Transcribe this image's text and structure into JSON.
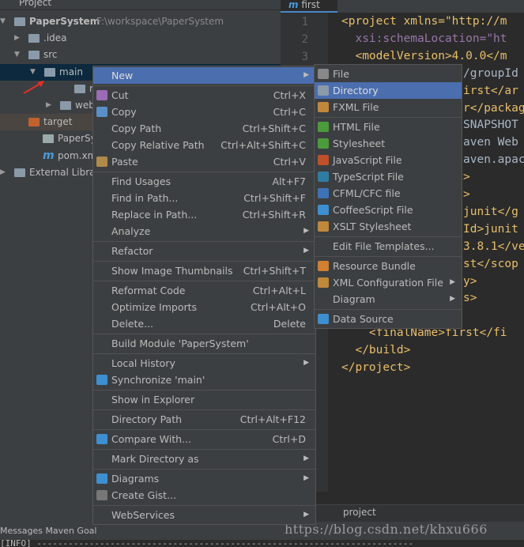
{
  "project_panel": {
    "title": "Project",
    "tree": [
      {
        "label": "PaperSystem",
        "path": "F:\\workspace\\PaperSystem",
        "icon": "module-folder-icon",
        "expanded": true
      },
      {
        "label": ".idea",
        "icon": "folder-icon",
        "expanded": false
      },
      {
        "label": "src",
        "icon": "folder-icon",
        "expanded": true
      },
      {
        "label": "main",
        "icon": "folder-icon",
        "expanded": true,
        "selected": true
      },
      {
        "label": "reso",
        "icon": "resources-folder-icon"
      },
      {
        "label": "web",
        "icon": "web-folder-icon",
        "expanded": false
      },
      {
        "label": "target",
        "icon": "excluded-folder-icon"
      },
      {
        "label": "PaperSyste",
        "icon": "iml-file-icon"
      },
      {
        "label": "pom.xml",
        "icon": "maven-icon"
      },
      {
        "label": "External Librar",
        "icon": "libraries-icon",
        "expanded": false
      }
    ]
  },
  "editor": {
    "tab": "first",
    "line_numbers": [
      "1",
      "2",
      "3"
    ],
    "lines": [
      "<project xmlns=\"http://m",
      "  xsi:schemaLocation=\"ht",
      "  <modelVersion>4.0.0</m",
      "/groupId",
      "irst</ar",
      "r</packag",
      "SNAPSHOT",
      "aven Web",
      "aven.apac",
      ">",
      ">",
      "junit</g",
      "Id>junit",
      "3.8.1</ve",
      "st</scop",
      "y>",
      "s>",
      "",
      "    <finalName>first</fi",
      "  </build>",
      "</project>"
    ],
    "breadcrumb": "project"
  },
  "context_menu": [
    {
      "label": "New",
      "submenu": true,
      "highlighted": true
    },
    {
      "sep": true
    },
    {
      "label": "Cut",
      "shortcut": "Ctrl+X",
      "icon": "scissors-icon"
    },
    {
      "label": "Copy",
      "shortcut": "Ctrl+C",
      "icon": "copy-icon"
    },
    {
      "label": "Copy Path",
      "shortcut": "Ctrl+Shift+C"
    },
    {
      "label": "Copy Relative Path",
      "shortcut": "Ctrl+Alt+Shift+C"
    },
    {
      "label": "Paste",
      "shortcut": "Ctrl+V",
      "icon": "paste-icon"
    },
    {
      "sep": true
    },
    {
      "label": "Find Usages",
      "shortcut": "Alt+F7"
    },
    {
      "label": "Find in Path...",
      "shortcut": "Ctrl+Shift+F"
    },
    {
      "label": "Replace in Path...",
      "shortcut": "Ctrl+Shift+R"
    },
    {
      "label": "Analyze",
      "submenu": true
    },
    {
      "sep": true
    },
    {
      "label": "Refactor",
      "submenu": true
    },
    {
      "sep": true
    },
    {
      "label": "Show Image Thumbnails",
      "shortcut": "Ctrl+Shift+T"
    },
    {
      "sep": true
    },
    {
      "label": "Reformat Code",
      "shortcut": "Ctrl+Alt+L"
    },
    {
      "label": "Optimize Imports",
      "shortcut": "Ctrl+Alt+O"
    },
    {
      "label": "Delete...",
      "shortcut": "Delete"
    },
    {
      "sep": true
    },
    {
      "label": "Build Module 'PaperSystem'"
    },
    {
      "sep": true
    },
    {
      "label": "Local History",
      "submenu": true
    },
    {
      "label": "Synchronize 'main'",
      "icon": "sync-icon"
    },
    {
      "sep": true
    },
    {
      "label": "Show in Explorer"
    },
    {
      "sep": true
    },
    {
      "label": "Directory Path",
      "shortcut": "Ctrl+Alt+F12"
    },
    {
      "sep": true
    },
    {
      "label": "Compare With...",
      "shortcut": "Ctrl+D",
      "icon": "compare-icon"
    },
    {
      "sep": true
    },
    {
      "label": "Mark Directory as",
      "submenu": true
    },
    {
      "sep": true
    },
    {
      "label": "Diagrams",
      "submenu": true,
      "icon": "diagram-icon"
    },
    {
      "label": "Create Gist...",
      "icon": "github-icon"
    },
    {
      "sep": true
    },
    {
      "label": "WebServices",
      "submenu": true
    }
  ],
  "new_submenu": [
    {
      "label": "File",
      "icon": "file-icon"
    },
    {
      "label": "Directory",
      "icon": "folder-icon",
      "highlighted": true
    },
    {
      "label": "FXML File",
      "icon": "fxml-file-icon"
    },
    {
      "sep": true
    },
    {
      "label": "HTML File",
      "icon": "html-file-icon"
    },
    {
      "label": "Stylesheet",
      "icon": "css-file-icon"
    },
    {
      "label": "JavaScript File",
      "icon": "js-file-icon"
    },
    {
      "label": "TypeScript File",
      "icon": "ts-file-icon"
    },
    {
      "label": "CFML/CFC file",
      "icon": "cf-file-icon"
    },
    {
      "label": "CoffeeScript File",
      "icon": "coffee-file-icon"
    },
    {
      "label": "XSLT Stylesheet",
      "icon": "xslt-file-icon"
    },
    {
      "sep": true
    },
    {
      "label": "Edit File Templates..."
    },
    {
      "sep": true
    },
    {
      "label": "Resource Bundle",
      "icon": "resource-bundle-icon"
    },
    {
      "label": "XML Configuration File",
      "submenu": true,
      "icon": "xml-file-icon"
    },
    {
      "label": "Diagram",
      "submenu": true
    },
    {
      "sep": true
    },
    {
      "label": "Data Source",
      "icon": "database-icon"
    }
  ],
  "bottom": {
    "tool_tabs": "Messages Maven Goal",
    "console": "[INFO] ------------------------------------------------------------------------"
  },
  "watermark": "https://blog.csdn.net/khxu666",
  "colors": {
    "highlight": "#4b6eaf",
    "selection": "#0d293e",
    "panel": "#3c3f41",
    "editor": "#2b2b2b"
  }
}
